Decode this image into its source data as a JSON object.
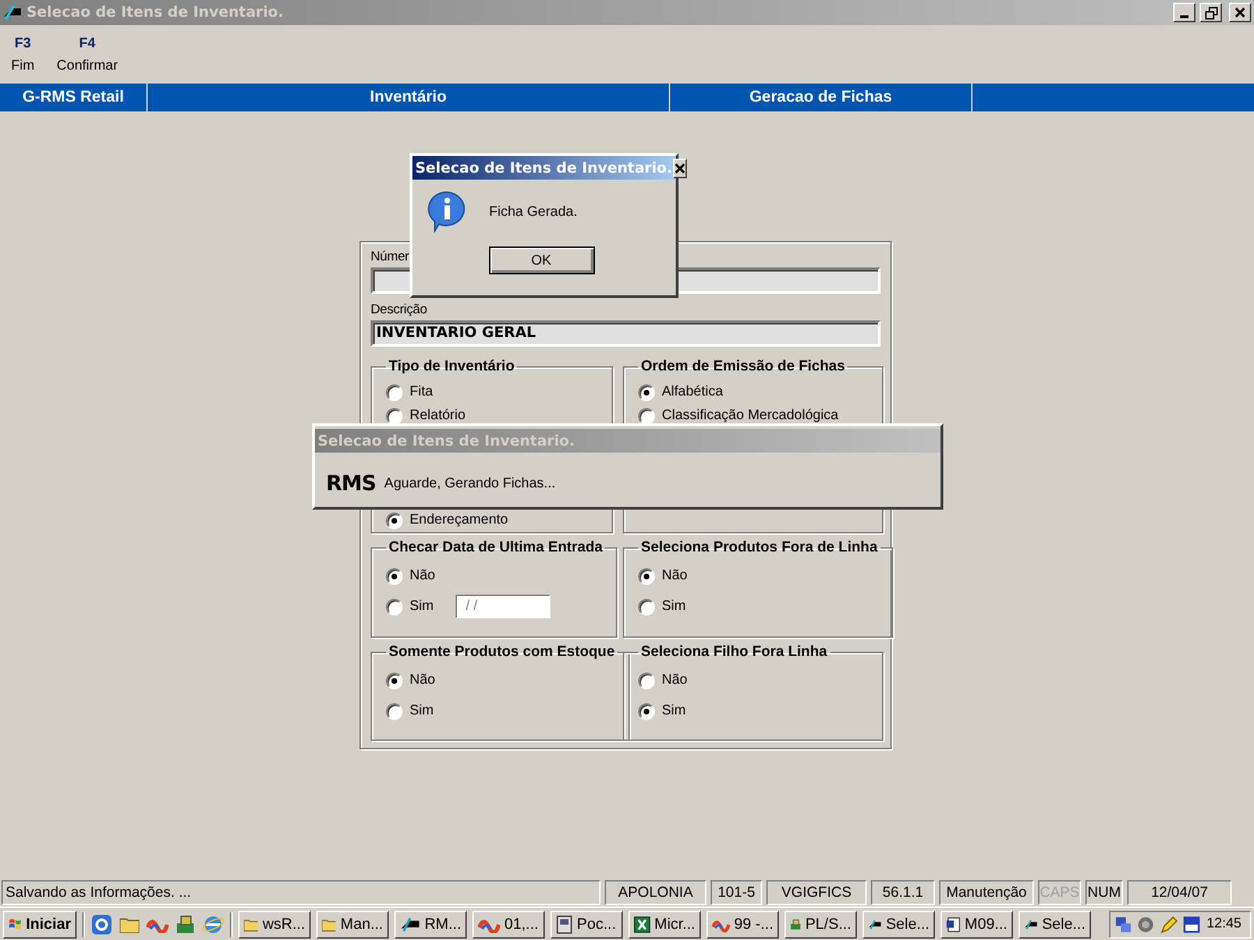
{
  "window": {
    "title": "Selecao de Itens de Inventario."
  },
  "toolbar": [
    {
      "key": "F3",
      "label": "Fim"
    },
    {
      "key": "F4",
      "label": "Confirmar"
    }
  ],
  "header_bar": [
    "G-RMS Retail",
    "Inventário",
    "Geracao de Fichas"
  ],
  "form": {
    "numero_label": "Númer",
    "descricao_label": "Descrição",
    "descricao_value": "INVENTARIO GERAL"
  },
  "groups": [
    {
      "title": "Tipo de Inventário",
      "options": [
        {
          "label": "Fita",
          "selected": false
        },
        {
          "label": "Relatório",
          "selected": false
        },
        {
          "label": "Endereçamento",
          "selected": true
        }
      ]
    },
    {
      "title": "Ordem de Emissão de Fichas",
      "options": [
        {
          "label": "Alfabética",
          "selected": true
        },
        {
          "label": "Classificação Mercadológica",
          "selected": false
        }
      ]
    },
    {
      "title": "Checar Data de Ultima Entrada",
      "options": [
        {
          "label": "Não",
          "selected": true
        },
        {
          "label": "Sim",
          "selected": false
        }
      ],
      "date_value": "/ /"
    },
    {
      "title": "Seleciona Produtos Fora de Linha",
      "options": [
        {
          "label": "Não",
          "selected": true
        },
        {
          "label": "Sim",
          "selected": false
        }
      ]
    },
    {
      "title": "Somente Produtos com Estoque",
      "options": [
        {
          "label": "Não",
          "selected": true
        },
        {
          "label": "Sim",
          "selected": false
        }
      ]
    },
    {
      "title": "Seleciona Filho Fora Linha",
      "options": [
        {
          "label": "Não",
          "selected": false
        },
        {
          "label": "Sim",
          "selected": true
        }
      ]
    }
  ],
  "info_dialog": {
    "title": "Selecao de Itens de Inventario.",
    "message": "Ficha Gerada.",
    "button": "OK"
  },
  "progress_dialog": {
    "title": "Selecao de Itens de Inventario.",
    "logo": "RMS",
    "message": "Aguarde, Gerando Fichas..."
  },
  "status_bar": {
    "message": "Salvando as Informações. ...",
    "panels": [
      {
        "text": "APOLONIA",
        "disabled": false
      },
      {
        "text": "101-5",
        "disabled": false
      },
      {
        "text": "VGIGFICS",
        "disabled": false
      },
      {
        "text": "56.1.1",
        "disabled": false
      },
      {
        "text": "Manutenção",
        "disabled": false
      },
      {
        "text": "CAPS",
        "disabled": true
      },
      {
        "text": "NUM",
        "disabled": false
      },
      {
        "text": "12/04/07",
        "disabled": false
      }
    ]
  },
  "taskbar": {
    "start": "Iniciar",
    "tasks": [
      {
        "label": "wsR..."
      },
      {
        "label": "Man..."
      },
      {
        "label": "RM..."
      },
      {
        "label": "01,..."
      },
      {
        "label": "Poc..."
      },
      {
        "label": "Micr..."
      },
      {
        "label": "99 -..."
      },
      {
        "label": "PL/S..."
      },
      {
        "label": "Sele..."
      },
      {
        "label": "M09..."
      },
      {
        "label": "Sele..."
      }
    ],
    "clock": "12:45"
  }
}
